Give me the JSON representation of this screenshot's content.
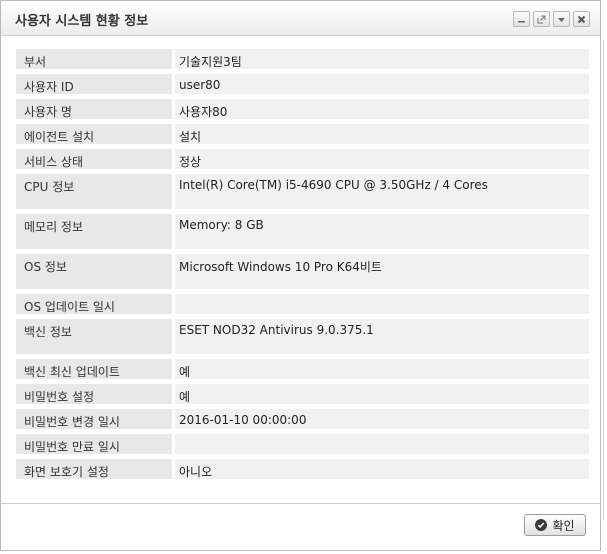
{
  "dialog": {
    "title": "사용자 시스템 현황 정보",
    "ok_label": "확인"
  },
  "icons": {
    "minimize": "minimize-icon",
    "popout": "popout-icon",
    "dropdown": "chevron-down-icon",
    "close": "close-icon",
    "ok": "check-circle-icon"
  },
  "rows": [
    {
      "label": "부서",
      "value": "기술지원3팀"
    },
    {
      "label": "사용자 ID",
      "value": "user80"
    },
    {
      "label": "사용자 명",
      "value": "사용자80"
    },
    {
      "label": "에이전트 설치",
      "value": "설치"
    },
    {
      "label": "서비스 상태",
      "value": "정상"
    },
    {
      "label": "CPU 정보",
      "value": "Intel(R) Core(TM) i5-4690 CPU @ 3.50GHz / 4 Cores"
    },
    {
      "label": "메모리 정보",
      "value": "Memory: 8 GB"
    },
    {
      "label": "OS 정보",
      "value": "Microsoft Windows 10 Pro K64비트"
    },
    {
      "label": "OS 업데이트 일시",
      "value": ""
    },
    {
      "label": "백신 정보",
      "value": "ESET NOD32 Antivirus 9.0.375.1"
    },
    {
      "label": "백신 최신 업데이트",
      "value": "예"
    },
    {
      "label": "비밀번호 설정",
      "value": "예"
    },
    {
      "label": "비밀번호 변경 일시",
      "value": "2016-01-10 00:00:00"
    },
    {
      "label": "비밀번호 만료 일시",
      "value": ""
    },
    {
      "label": "화면 보호기 설정",
      "value": "아니오"
    }
  ]
}
